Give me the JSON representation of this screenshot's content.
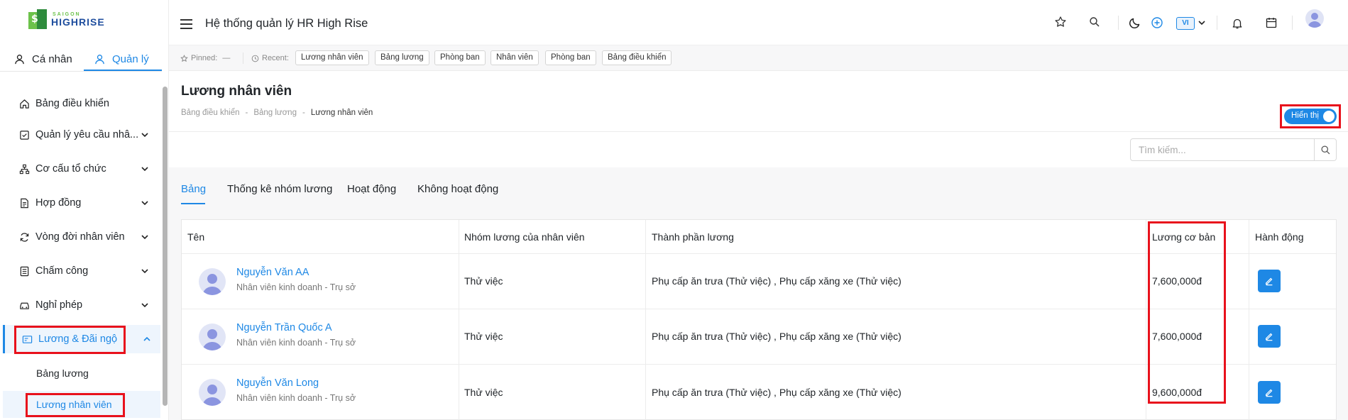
{
  "app": {
    "title": "Hệ thống quản lý HR High Rise"
  },
  "logo": {
    "line1": "SAIGON",
    "line2": "HIGHRISE"
  },
  "role_tabs": {
    "personal": "Cá nhân",
    "manage": "Quản lý"
  },
  "sidebar": {
    "items": [
      {
        "label": "Bảng điều khiển"
      },
      {
        "label": "Quản lý yêu cầu nhâ..."
      },
      {
        "label": "Cơ cấu tổ chức"
      },
      {
        "label": "Hợp đồng"
      },
      {
        "label": "Vòng đời nhân viên"
      },
      {
        "label": "Chấm công"
      },
      {
        "label": "Nghỉ phép"
      },
      {
        "label": "Lương & Đãi ngộ"
      }
    ],
    "sub_items": [
      {
        "label": "Bảng lương"
      },
      {
        "label": "Lương nhân viên"
      }
    ]
  },
  "topbar": {
    "lang": "VI"
  },
  "pinbar": {
    "pinned_label": "Pinned:",
    "pinned_value": "—",
    "recent_label": "Recent:",
    "recent": [
      "Lương nhân viên",
      "Bảng lương",
      "Phòng ban",
      "Nhân viên",
      "Phòng ban",
      "Bảng điều khiển"
    ]
  },
  "page": {
    "title": "Lương nhân viên",
    "breadcrumb": [
      "Bảng điều khiển",
      "Bảng lương",
      "Lương nhân viên"
    ],
    "breadcrumb_sep": "-",
    "toggle_label": "Hiển thị"
  },
  "search": {
    "placeholder": "Tìm kiếm..."
  },
  "tabs": [
    "Bảng",
    "Thống kê nhóm lương",
    "Hoạt động",
    "Không hoạt động"
  ],
  "table": {
    "headers": [
      "Tên",
      "Nhóm lương của nhân viên",
      "Thành phần lương",
      "Lương cơ bản",
      "Hành động"
    ],
    "rows": [
      {
        "name": "Nguyễn Văn AA",
        "position": "Nhân viên kinh doanh - Trụ sở",
        "group": "Thử việc",
        "components": "Phụ cấp ăn trưa (Thử việc) , Phụ cấp xăng xe (Thử việc)",
        "salary": "7,600,000đ"
      },
      {
        "name": "Nguyễn Trần Quốc A",
        "position": "Nhân viên kinh doanh - Trụ sở",
        "group": "Thử việc",
        "components": "Phụ cấp ăn trưa (Thử việc) , Phụ cấp xăng xe (Thử việc)",
        "salary": "7,600,000đ"
      },
      {
        "name": "Nguyễn Văn Long",
        "position": "Nhân viên kinh doanh - Trụ sở",
        "group": "Thử việc",
        "components": "Phụ cấp ăn trưa (Thử việc) , Phụ cấp xăng xe (Thử việc)",
        "salary": "9,600,000đ"
      }
    ]
  },
  "colors": {
    "accent": "#1e88e5",
    "highlight": "#e8111c"
  }
}
